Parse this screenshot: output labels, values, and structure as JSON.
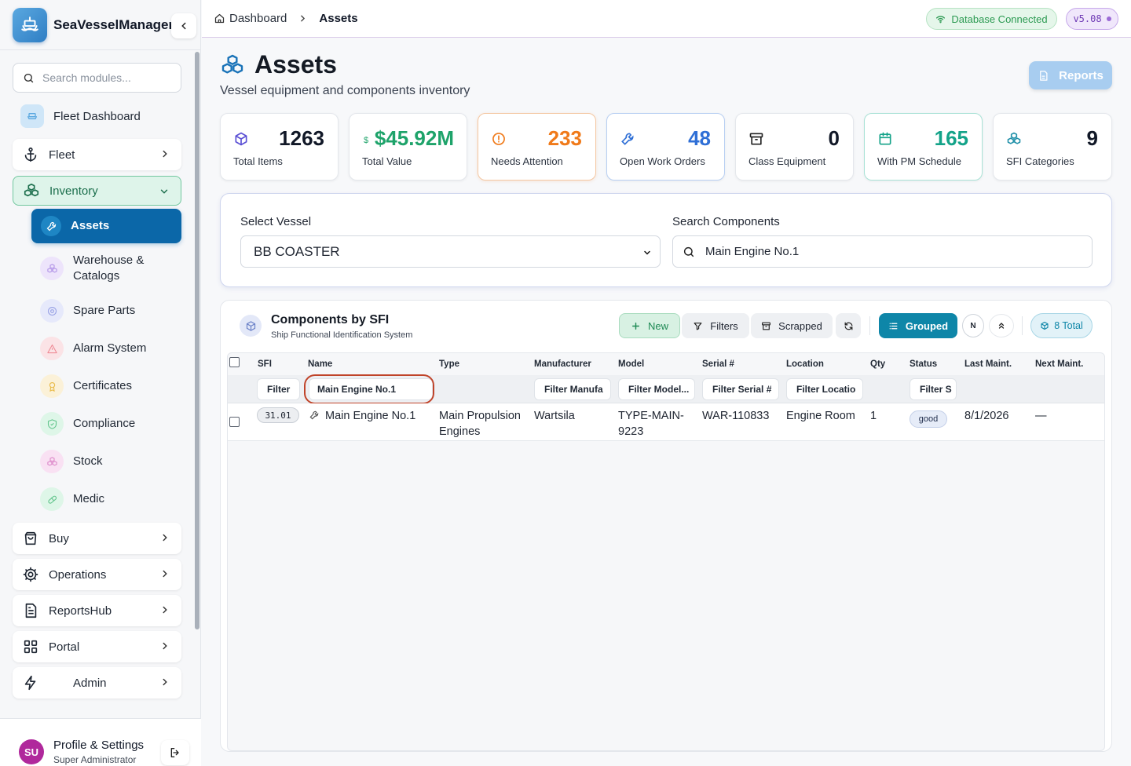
{
  "app": {
    "name": "SeaVesselManager"
  },
  "sidebar": {
    "search_placeholder": "Search modules...",
    "items": {
      "fleet_dashboard": "Fleet Dashboard",
      "fleet": "Fleet",
      "inventory": "Inventory",
      "buy": "Buy",
      "operations": "Operations",
      "reportshub": "ReportsHub",
      "portal": "Portal",
      "admin": "Admin"
    },
    "inventory_sub": {
      "assets": "Assets",
      "warehouse": "Warehouse & Catalogs",
      "spare_parts": "Spare Parts",
      "alarm_system": "Alarm System",
      "certificates": "Certificates",
      "compliance": "Compliance",
      "stock": "Stock",
      "medic": "Medic"
    },
    "profile": {
      "initials": "SU",
      "name": "Profile & Settings",
      "role": "Super Administrator"
    }
  },
  "topbar": {
    "breadcrumb_home": "Dashboard",
    "breadcrumb_current": "Assets",
    "db_status": "Database Connected",
    "version": "v5.08"
  },
  "page": {
    "title": "Assets",
    "subtitle": "Vessel equipment and components inventory",
    "reports_button": "Reports"
  },
  "stats": {
    "total_items": {
      "value": "1263",
      "label": "Total Items"
    },
    "total_value": {
      "currency": "$",
      "value": "$45.92M",
      "label": "Total Value"
    },
    "needs_attention": {
      "value": "233",
      "label": "Needs Attention"
    },
    "open_work_orders": {
      "value": "48",
      "label": "Open Work Orders"
    },
    "class_equipment": {
      "value": "0",
      "label": "Class Equipment"
    },
    "pm_schedule": {
      "value": "165",
      "label": "With PM Schedule"
    },
    "sfi_categories": {
      "value": "9",
      "label": "SFI Categories"
    }
  },
  "filters": {
    "vessel_label": "Select Vessel",
    "vessel_value": "BB COASTER",
    "search_label": "Search Components",
    "search_value": "Main Engine No.1"
  },
  "components": {
    "title": "Components by SFI",
    "subtitle": "Ship Functional Identification System",
    "toolbar": {
      "new": "New",
      "filters": "Filters",
      "scrapped": "Scrapped",
      "grouped": "Grouped",
      "n": "N",
      "total": "8 Total"
    },
    "columns": {
      "sfi": "SFI",
      "name": "Name",
      "type": "Type",
      "manufacturer": "Manufacturer",
      "model": "Model",
      "serial": "Serial #",
      "location": "Location",
      "qty": "Qty",
      "status": "Status",
      "last_maint": "Last Maint.",
      "next_maint": "Next Maint."
    },
    "column_filters": {
      "sfi": "Filter",
      "name": "Main Engine No.1",
      "manufacturer": "Filter Manufa",
      "model": "Filter Model...",
      "serial": "Filter Serial #",
      "location": "Filter Locatio",
      "status": "Filter S"
    },
    "rows": [
      {
        "sfi": "31.01",
        "name": "Main Engine No.1",
        "type": "Main Propulsion Engines",
        "manufacturer": "Wartsila",
        "model": "TYPE-MAIN-9223",
        "serial": "WAR-110833",
        "location": "Engine Room",
        "qty": "1",
        "status": "good",
        "last_maint": "8/1/2026",
        "next_maint": "—"
      }
    ]
  },
  "colors": {
    "primary": "#0b67a8",
    "inventory_bg": "#def4ea",
    "inventory_text": "#1b6e4c",
    "attention": "#f07a1a",
    "value_green": "#1ea36a",
    "teal": "#14a389",
    "blue_stat": "#2f6fd6",
    "grouped": "#0e86a8",
    "highlight_ring": "#c0442a"
  }
}
